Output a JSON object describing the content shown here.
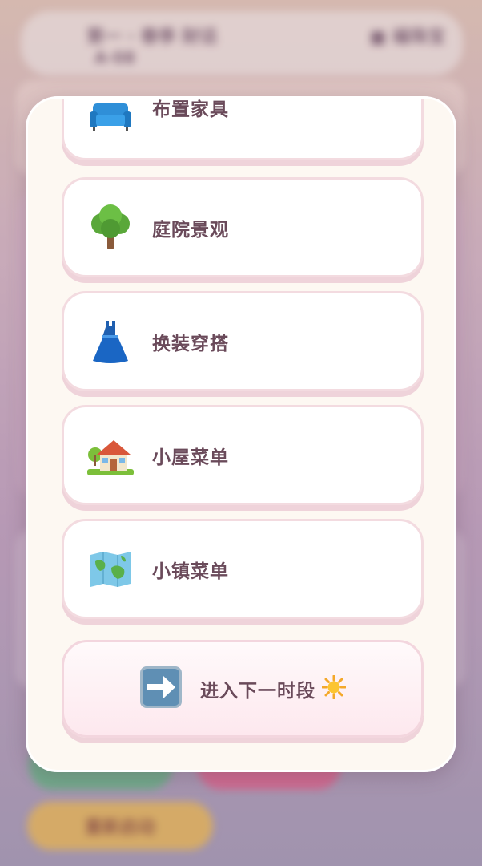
{
  "background": {
    "topbar_text": "第一 · 春季 財话",
    "topbar_sub": "A·08",
    "topbar_right": "■ 编珠宝",
    "bottom_button": "重新启动"
  },
  "menu": {
    "items": [
      {
        "label": "布置家具",
        "icon": "sofa-icon"
      },
      {
        "label": "庭院景观",
        "icon": "tree-icon"
      },
      {
        "label": "换装穿搭",
        "icon": "dress-icon"
      },
      {
        "label": "小屋菜单",
        "icon": "house-icon"
      },
      {
        "label": "小镇菜单",
        "icon": "map-icon"
      }
    ],
    "next_button": {
      "label": "进入下一时段",
      "icon": "right-arrow-icon",
      "trail_icon": "sun-icon"
    }
  },
  "colors": {
    "text": "#6a4a5a",
    "modal_bg": "#fdf8f2",
    "card_border": "#f3dbe0"
  }
}
